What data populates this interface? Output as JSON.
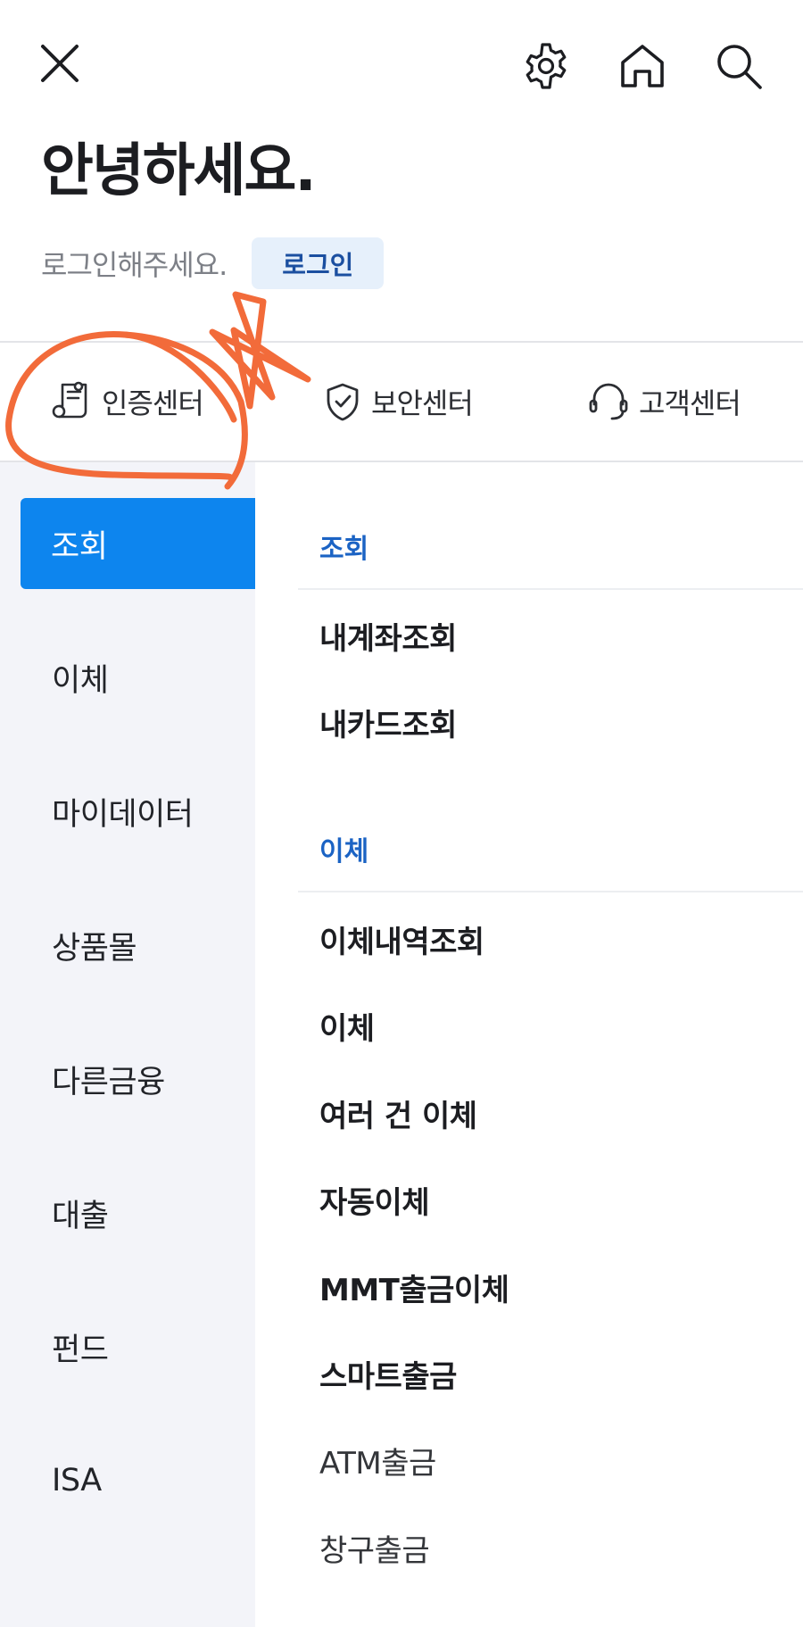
{
  "header": {
    "greeting": "안녕하세요.",
    "login_prompt": "로그인해주세요.",
    "login_button": "로그인",
    "icons": [
      "close-icon",
      "gear-icon",
      "home-icon",
      "search-icon"
    ]
  },
  "centers": [
    {
      "label": "인증센터",
      "icon": "certificate-icon"
    },
    {
      "label": "보안센터",
      "icon": "shield-check-icon"
    },
    {
      "label": "고객센터",
      "icon": "headset-icon"
    }
  ],
  "sidebar": {
    "items": [
      {
        "label": "조회",
        "active": true
      },
      {
        "label": "이체"
      },
      {
        "label": "마이데이터"
      },
      {
        "label": "상품몰"
      },
      {
        "label": "다른금융"
      },
      {
        "label": "대출"
      },
      {
        "label": "펀드"
      },
      {
        "label": "ISA"
      }
    ]
  },
  "content": {
    "sections": [
      {
        "title": "조회",
        "items": [
          "내계좌조회",
          "내카드조회"
        ]
      },
      {
        "title": "이체",
        "items": [
          "이체내역조회",
          "이체",
          "여러 건 이체",
          "자동이체",
          "MMT출금이체",
          "스마트출금",
          "ATM출금",
          "창구출금"
        ]
      }
    ]
  },
  "colors": {
    "accent": "#0d85ee",
    "section_title": "#1b63c4",
    "login_button_bg": "#e6f0fb",
    "sidebar_bg": "#f3f4f9",
    "annotation": "#f26b3a"
  }
}
